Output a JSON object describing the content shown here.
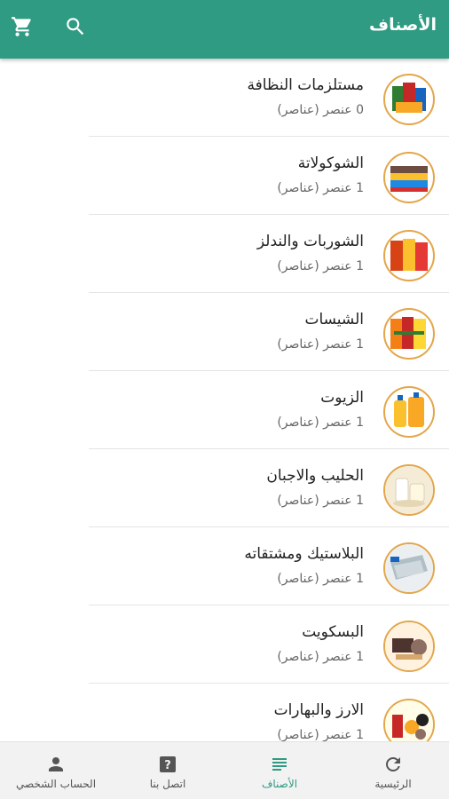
{
  "appbar": {
    "title": "الأصناف",
    "cart_icon": "cart-icon",
    "search_icon": "search-icon"
  },
  "colors": {
    "primary": "#2f9b82",
    "thumb_border": "#e3a64a",
    "nav_bg": "#f2f2f2"
  },
  "categories": [
    {
      "title": "مستلزمات النظافة",
      "count": "0 عنصر (عناصر)"
    },
    {
      "title": "الشوكولاتة",
      "count": "1 عنصر (عناصر)"
    },
    {
      "title": "الشوربات والندلز",
      "count": "1 عنصر (عناصر)"
    },
    {
      "title": "الشيسات",
      "count": "1 عنصر (عناصر)"
    },
    {
      "title": "الزيوت",
      "count": "1 عنصر (عناصر)"
    },
    {
      "title": "الحليب والاجبان",
      "count": "1 عنصر (عناصر)"
    },
    {
      "title": "البلاستيك ومشتقاته",
      "count": "1 عنصر (عناصر)"
    },
    {
      "title": "البسكويت",
      "count": "1 عنصر (عناصر)"
    },
    {
      "title": "الارز والبهارات",
      "count": "1 عنصر (عناصر)"
    }
  ],
  "bottom_nav": [
    {
      "label": "الحساب الشخصي",
      "icon": "person-icon",
      "active": false
    },
    {
      "label": "اتصل بنا",
      "icon": "help-icon",
      "active": false
    },
    {
      "label": "الأصناف",
      "icon": "list-icon",
      "active": true
    },
    {
      "label": "الرئيسية",
      "icon": "refresh-icon",
      "active": false
    }
  ]
}
